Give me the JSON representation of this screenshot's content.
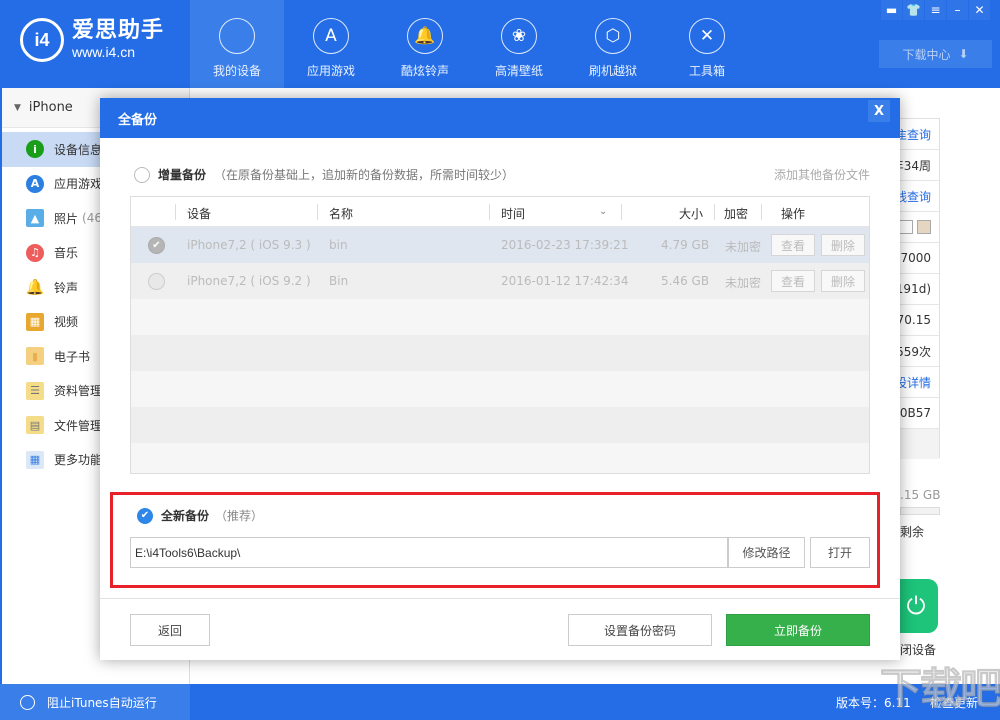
{
  "app": {
    "logo_mark": "i4",
    "logo_title": "爱思助手",
    "logo_url": "www.i4.cn"
  },
  "nav": {
    "items": [
      {
        "label": "我的设备",
        "icon": "apple-icon",
        "glyph": "",
        "active": true
      },
      {
        "label": "应用游戏",
        "icon": "app-store-icon",
        "glyph": "A"
      },
      {
        "label": "酷炫铃声",
        "icon": "bell-icon",
        "glyph": "🔔"
      },
      {
        "label": "高清壁纸",
        "icon": "flower-icon",
        "glyph": "❀"
      },
      {
        "label": "刷机越狱",
        "icon": "box-icon",
        "glyph": "⬡"
      },
      {
        "label": "工具箱",
        "icon": "tools-icon",
        "glyph": "✕"
      }
    ]
  },
  "window_controls": {
    "feedback": "▬",
    "skin": "👕",
    "menu": "≡",
    "minimize": "–",
    "close": "✕"
  },
  "download_center": {
    "label": "下载中心",
    "icon": "⬇"
  },
  "sidebar": {
    "device_name": "iPhone",
    "items": [
      {
        "label": "设备信息",
        "icon": "info-icon",
        "glyph": "i",
        "color": "#1a9e1a",
        "active": true
      },
      {
        "label": "应用游戏",
        "icon": "app-store-icon",
        "glyph": "A",
        "color": "#2a7fe0"
      },
      {
        "label": "照片",
        "count": "(46",
        "icon": "photo-icon",
        "glyph": "▲",
        "color": "#5aaee8"
      },
      {
        "label": "音乐",
        "icon": "music-icon",
        "glyph": "♫",
        "color": "#ee5c5c"
      },
      {
        "label": "铃声",
        "icon": "bell-icon",
        "glyph": "🔔",
        "color": "#3d9af0"
      },
      {
        "label": "视频",
        "icon": "video-icon",
        "glyph": "▦",
        "color": "#8a7a5a"
      },
      {
        "label": "电子书",
        "icon": "book-icon",
        "glyph": "▮",
        "color": "#f0c060"
      },
      {
        "label": "资料管理",
        "icon": "contacts-icon",
        "glyph": "☰",
        "color": "#e8c860"
      },
      {
        "label": "文件管理",
        "icon": "file-icon",
        "glyph": "▤",
        "color": "#e8c860"
      },
      {
        "label": "更多功能",
        "icon": "more-icon",
        "glyph": "▦",
        "color": "#5a8ed0"
      }
    ]
  },
  "info_panel": {
    "rows": [
      {
        "text": "隹查询",
        "link": true
      },
      {
        "text": "年34周",
        "link": false
      },
      {
        "text": "线查询",
        "link": true
      },
      {
        "text": "3 ▢",
        "link": false
      },
      {
        "text": "7000",
        "link": false
      },
      {
        "text": "191d)",
        "link": false
      },
      {
        "text": "70.15",
        "link": false
      },
      {
        "text": "559次",
        "link": false
      },
      {
        "text": "设详情",
        "link": true
      },
      {
        "text": "0B57",
        "link": false
      }
    ],
    "storage_text": ".15 GB",
    "storage_used_fraction": 0.0,
    "remain_label": "剩余",
    "power_label": "闭设备"
  },
  "modal": {
    "title": "全备份",
    "close_glyph": "X",
    "incremental": {
      "title": "增量备份",
      "description": "（在原备份基础上，追加新的备份数据，所需时间较少）",
      "selected": false,
      "add_other_label": "添加其他备份文件"
    },
    "table": {
      "columns": [
        "设备",
        "名称",
        "时间",
        "大小",
        "加密",
        "操作"
      ],
      "sort_glyph": "⌄",
      "rows": [
        {
          "device": "iPhone7,2 ( iOS 9.3 )",
          "name": "bin",
          "time": "2016-02-23 17:39:21",
          "size": "4.79 GB",
          "encrypted": "未加密",
          "view": "查看",
          "delete": "删除",
          "checked": true
        },
        {
          "device": "iPhone7,2 ( iOS 9.2 )",
          "name": "Bin",
          "time": "2016-01-12 17:42:34",
          "size": "5.46 GB",
          "encrypted": "未加密",
          "view": "查看",
          "delete": "删除",
          "checked": false
        }
      ]
    },
    "full": {
      "title": "全新备份",
      "recommend": "（推荐）",
      "selected": true,
      "path": "E:\\i4Tools6\\Backup\\",
      "change_path_label": "修改路径",
      "open_label": "打开"
    },
    "footer": {
      "back_label": "返回",
      "set_password_label": "设置备份密码",
      "backup_now_label": "立即备份"
    }
  },
  "statusbar": {
    "itunes_label": "阻止iTunes自动运行",
    "version": "版本号：6.11",
    "check_update": "检查更新"
  },
  "watermark": "下载吧"
}
